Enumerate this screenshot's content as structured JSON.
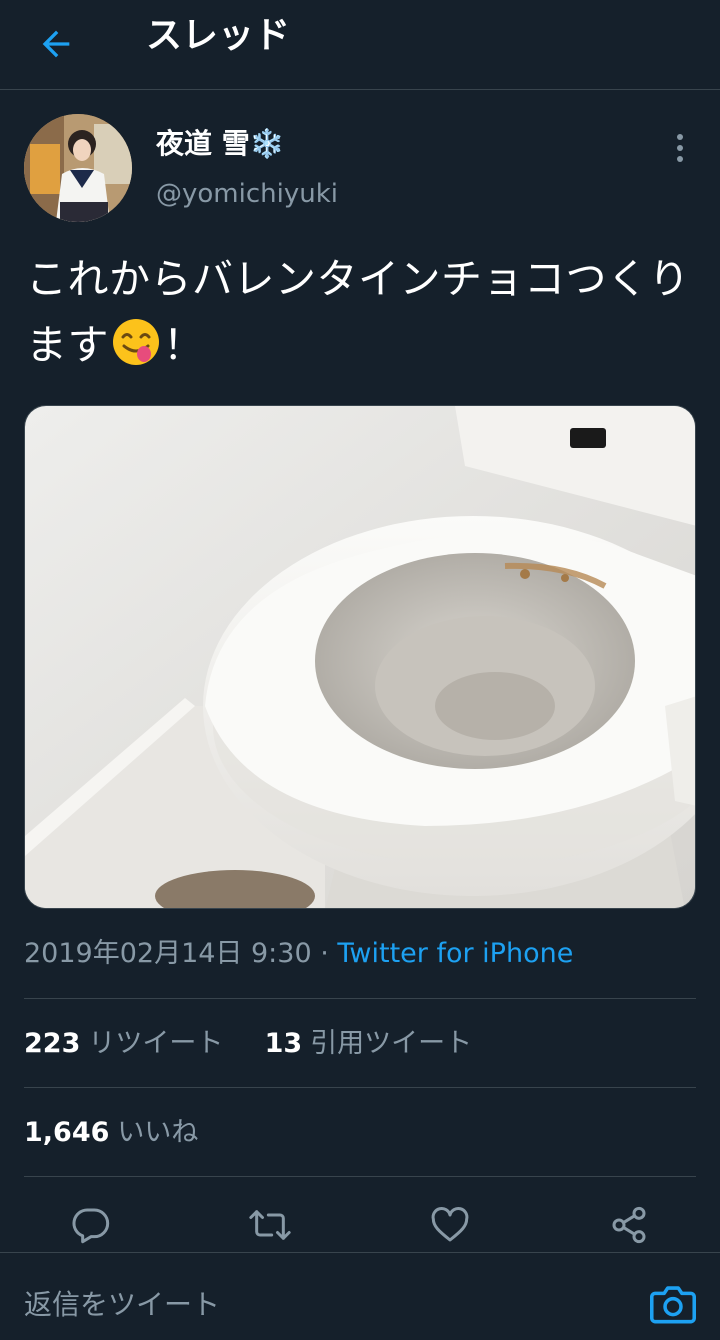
{
  "header": {
    "title": "スレッド"
  },
  "tweet": {
    "author_name": "夜道 雪❄️",
    "author_handle": "@yomichiyuki",
    "text_before_emoji": "これからバレンタインチョコつくります",
    "text_after_emoji": "！",
    "emoji": "face-savoring-food-emoji",
    "timestamp": "2019年02月14日 9:30 · ",
    "source": "Twitter for iPhone"
  },
  "stats": {
    "retweets_count": "223",
    "retweets_label": "リツイート",
    "quotes_count": "13",
    "quotes_label": "引用ツイート",
    "likes_count": "1,646",
    "likes_label": "いいね"
  },
  "reply": {
    "placeholder": "返信をツイート"
  },
  "icons": {
    "back": "arrow-left-icon",
    "more": "more-vertical-icon",
    "reply": "reply-bubble-icon",
    "retweet": "retweet-icon",
    "like": "heart-icon",
    "share": "share-icon",
    "camera": "camera-icon"
  },
  "colors": {
    "background": "#15202b",
    "accent": "#1da1f2",
    "secondary_text": "#8899a6",
    "divider": "#38444d"
  }
}
